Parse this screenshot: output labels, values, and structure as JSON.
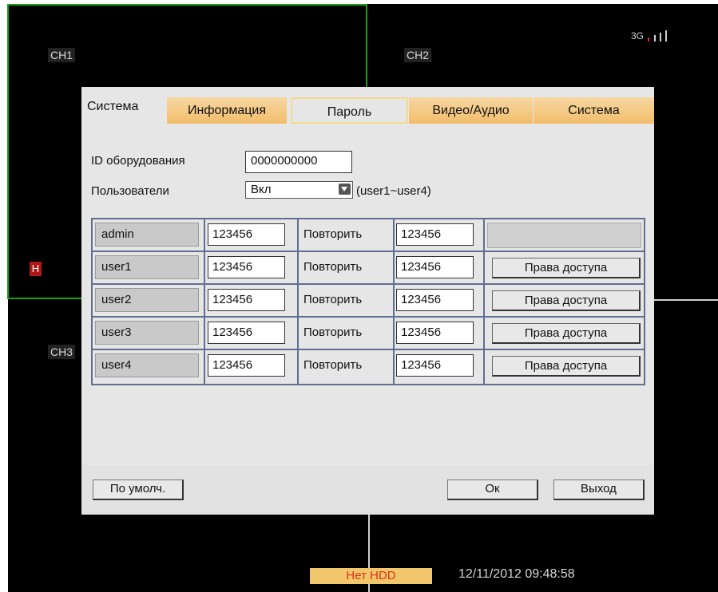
{
  "channels": {
    "ch1": "CH1",
    "ch2": "CH2",
    "ch3": "CH3",
    "marker": "H"
  },
  "signal": {
    "label": "3G",
    "bars": 4,
    "active_bars": 1,
    "icon": "signal-bars-icon"
  },
  "dialog": {
    "tabs": [
      {
        "label": "Система"
      },
      {
        "label": "Информация"
      },
      {
        "label": "Пароль",
        "active": true
      },
      {
        "label": "Видео/Аудио"
      },
      {
        "label": "Система"
      }
    ],
    "device_id": {
      "label": "ID оборудования",
      "value": "0000000000"
    },
    "users_setting": {
      "label": "Пользователи",
      "value": "Вкл",
      "hint": "(user1~user4)"
    },
    "repeat_label": "Повторить",
    "access_label": "Права доступа",
    "rows": [
      {
        "name": "admin",
        "password": "123456",
        "repeat": "123456",
        "has_access": false
      },
      {
        "name": "user1",
        "password": "123456",
        "repeat": "123456",
        "has_access": true
      },
      {
        "name": "user2",
        "password": "123456",
        "repeat": "123456",
        "has_access": true
      },
      {
        "name": "user3",
        "password": "123456",
        "repeat": "123456",
        "has_access": true
      },
      {
        "name": "user4",
        "password": "123456",
        "repeat": "123456",
        "has_access": true
      }
    ],
    "buttons": {
      "default": "По умолч.",
      "ok": "Ок",
      "exit": "Выход"
    }
  },
  "status": {
    "hdd": "Нет HDD",
    "datetime": "12/11/2012 09:48:58"
  },
  "colors": {
    "accent_orange": "#f2bd6b",
    "selection_green": "#1aa01a",
    "hdd_text": "#d8321a"
  }
}
